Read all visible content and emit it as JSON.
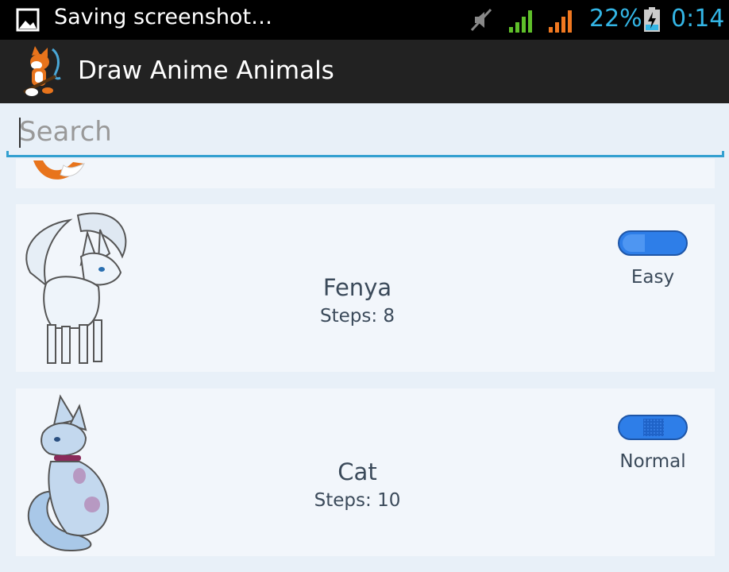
{
  "status_bar": {
    "notification_text": "Saving screenshot…",
    "battery_percent": "22%",
    "time": "0:14",
    "icons": [
      "image-icon",
      "mute-icon",
      "signal-icon",
      "signal-icon",
      "battery-charging-icon"
    ]
  },
  "action_bar": {
    "title": "Draw Anime Animals",
    "icon": "fox-app-icon"
  },
  "search": {
    "placeholder": "Search",
    "value": ""
  },
  "animals": [
    {
      "name": "Fenya",
      "steps": "Steps: 8",
      "difficulty": "Easy",
      "image": "white-fox-icon"
    },
    {
      "name": "Cat",
      "steps": "Steps: 10",
      "difficulty": "Normal",
      "image": "blue-cat-icon"
    }
  ],
  "colors": {
    "accent": "#33b5e5",
    "action_bar": "#222222",
    "card": "#f2f6fb",
    "pill": "#2e7ee8"
  }
}
